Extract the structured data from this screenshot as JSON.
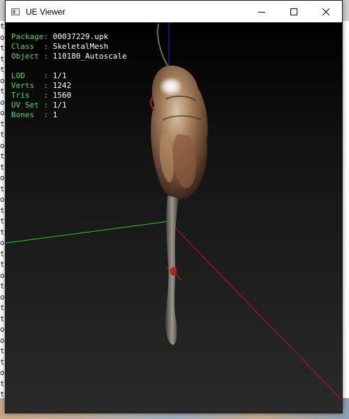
{
  "window": {
    "title": "UE Viewer",
    "controls": {
      "minimize_icon": "minimize-icon",
      "maximize_icon": "maximize-icon",
      "close_icon": "close-icon"
    }
  },
  "info": {
    "asset": [
      {
        "label": "Package: ",
        "value": "00037229.upk"
      },
      {
        "label": "Class  : ",
        "value": "SkeletalMesh"
      },
      {
        "label": "Object : ",
        "value": "110180_Autoscale"
      }
    ],
    "mesh": [
      {
        "label": "LOD    : ",
        "value": "1/1"
      },
      {
        "label": "Verts  : ",
        "value": "1242"
      },
      {
        "label": "Tris   : ",
        "value": "1560"
      },
      {
        "label": "UV Set : ",
        "value": "1/1"
      },
      {
        "label": "Bones  : ",
        "value": "1"
      }
    ]
  },
  "colors": {
    "info_label": "#4ddb4d",
    "info_value": "#ffffff",
    "axis_x": "#c01818",
    "axis_y": "#18d818",
    "axis_z": "#2020ff"
  },
  "background": {
    "left_terminal_chars": [
      "t",
      "o",
      "t",
      "t",
      "t",
      "o",
      "t",
      "o",
      "o",
      "t",
      "t",
      "o",
      "t",
      "t",
      "o",
      "t",
      "o",
      "t",
      "t",
      "t",
      "o",
      "t",
      "t",
      "o",
      "t",
      "o",
      "t",
      "t",
      "o",
      "o",
      "t",
      "t",
      "o",
      "t",
      "t"
    ]
  }
}
